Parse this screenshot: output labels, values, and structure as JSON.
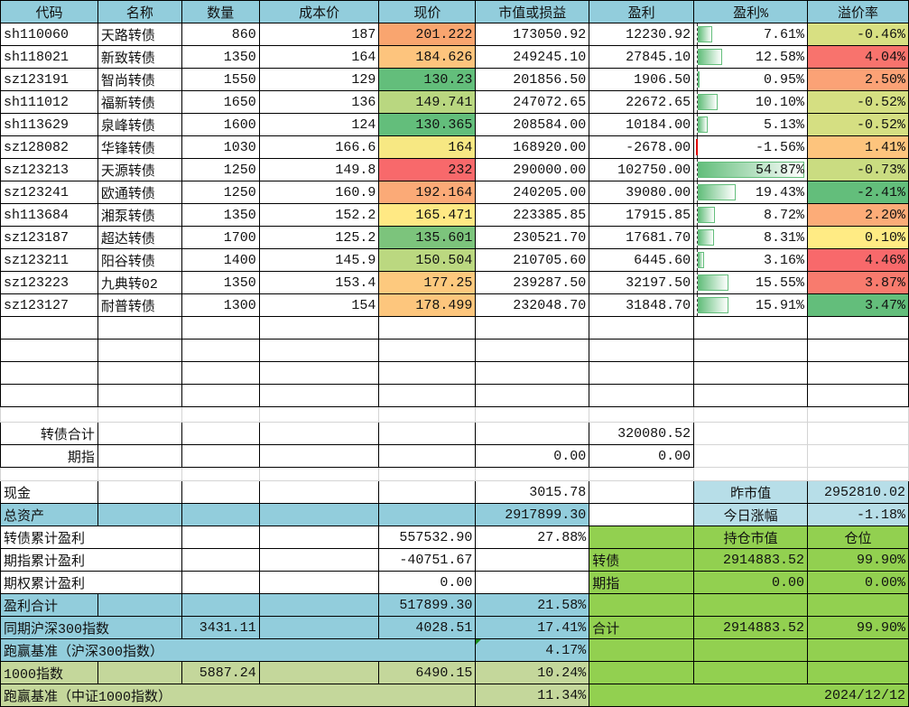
{
  "headers": [
    "代码",
    "名称",
    "数量",
    "成本价",
    "现价",
    "市值或损益",
    "盈利",
    "盈利%",
    "溢价率"
  ],
  "colors": {
    "header": "#92cddc",
    "blue": "#92cddc",
    "light_blue": "#b7dee8",
    "green": "#92d050",
    "olive": "#c4d79b",
    "bar": "#63be7b",
    "negative_bar": "#e00000"
  },
  "holdings": [
    {
      "code": "sh110060",
      "name": "天路转债",
      "qty": "860",
      "cost": "187",
      "price": "201.222",
      "mv": "173050.92",
      "profit": "12230.92",
      "profit_pct": "7.61%",
      "pct": 7.61,
      "premium": "-0.46%",
      "price_color": "#f9a56f",
      "premium_color": "#d8e082"
    },
    {
      "code": "sh118021",
      "name": "新致转债",
      "qty": "1350",
      "cost": "164",
      "price": "184.626",
      "mv": "249245.10",
      "profit": "27845.10",
      "profit_pct": "12.58%",
      "pct": 12.58,
      "premium": "4.04%",
      "price_color": "#fdc47d",
      "premium_color": "#f8736d"
    },
    {
      "code": "sz123191",
      "name": "智尚转债",
      "qty": "1550",
      "cost": "129",
      "price": "130.23",
      "mv": "201856.50",
      "profit": "1906.50",
      "profit_pct": "0.95%",
      "pct": 0.95,
      "premium": "2.50%",
      "price_color": "#63be7b",
      "premium_color": "#fba276"
    },
    {
      "code": "sh111012",
      "name": "福新转债",
      "qty": "1650",
      "cost": "136",
      "price": "149.741",
      "mv": "247072.65",
      "profit": "22672.65",
      "profit_pct": "10.10%",
      "pct": 10.1,
      "premium": "-0.52%",
      "price_color": "#b9d780",
      "premium_color": "#d5df82"
    },
    {
      "code": "sh113629",
      "name": "泉峰转债",
      "qty": "1600",
      "cost": "124",
      "price": "130.365",
      "mv": "208584.00",
      "profit": "10184.00",
      "profit_pct": "5.13%",
      "pct": 5.13,
      "premium": "-0.52%",
      "price_color": "#63be7b",
      "premium_color": "#d5df82"
    },
    {
      "code": "sz128082",
      "name": "华锋转债",
      "qty": "1030",
      "cost": "166.6",
      "price": "164",
      "mv": "168920.00",
      "profit": "-2678.00",
      "profit_pct": "-1.56%",
      "pct": -1.56,
      "premium": "1.41%",
      "price_color": "#f7e883",
      "premium_color": "#fdc47d"
    },
    {
      "code": "sz123213",
      "name": "天源转债",
      "qty": "1250",
      "cost": "149.8",
      "price": "232",
      "mv": "290000.00",
      "profit": "102750.00",
      "profit_pct": "54.87%",
      "pct": 54.87,
      "premium": "-0.73%",
      "price_color": "#f8696b",
      "premium_color": "#cadc81"
    },
    {
      "code": "sz123241",
      "name": "欧通转债",
      "qty": "1250",
      "cost": "160.9",
      "price": "192.164",
      "mv": "240205.00",
      "profit": "39080.00",
      "profit_pct": "19.43%",
      "pct": 19.43,
      "premium": "-2.41%",
      "price_color": "#fbaa77",
      "premium_color": "#63be7b"
    },
    {
      "code": "sh113684",
      "name": "湘泵转债",
      "qty": "1350",
      "cost": "152.2",
      "price": "165.471",
      "mv": "223385.85",
      "profit": "17915.85",
      "profit_pct": "8.72%",
      "pct": 8.72,
      "premium": "2.20%",
      "price_color": "#ffe984",
      "premium_color": "#fcac78"
    },
    {
      "code": "sz123187",
      "name": "超达转债",
      "qty": "1700",
      "cost": "125.2",
      "price": "135.601",
      "mv": "230521.70",
      "profit": "17681.70",
      "profit_pct": "8.31%",
      "pct": 8.31,
      "premium": "0.10%",
      "price_color": "#7cc47c",
      "premium_color": "#ffeb84"
    },
    {
      "code": "sz123211",
      "name": "阳谷转债",
      "qty": "1400",
      "cost": "145.9",
      "price": "150.504",
      "mv": "210705.60",
      "profit": "6445.60",
      "profit_pct": "3.16%",
      "pct": 3.16,
      "premium": "4.46%",
      "price_color": "#bbd880",
      "premium_color": "#f8696b"
    },
    {
      "code": "sz123223",
      "name": "九典转02",
      "qty": "1350",
      "cost": "153.4",
      "price": "177.25",
      "mv": "239287.50",
      "profit": "32197.50",
      "profit_pct": "15.55%",
      "pct": 15.55,
      "premium": "3.87%",
      "price_color": "#fdc97e",
      "premium_color": "#f87b6e"
    },
    {
      "code": "sz123127",
      "name": "耐普转债",
      "qty": "1300",
      "cost": "154",
      "price": "178.499",
      "mv": "232048.70",
      "profit": "31848.70",
      "profit_pct": "15.91%",
      "pct": 15.91,
      "premium": "3.47%",
      "price_color": "#fdc67d",
      "premium_color": "#63be7b"
    }
  ],
  "summary": {
    "bond_total_label": "转债合计",
    "bond_total": "320080.52",
    "futures_label": "期指",
    "futures_mv": "0.00",
    "futures_profit": "0.00",
    "cash_label": "现金",
    "cash": "3015.78",
    "prev_mv_label": "昨市值",
    "prev_mv": "2952810.02",
    "total_assets_label": "总资产",
    "total_assets": "2917899.30",
    "today_change_label": "今日涨幅",
    "today_change": "-1.18%",
    "bond_cum_label": "转债累计盈利",
    "bond_cum": "557532.90",
    "bond_cum_pct": "27.88%",
    "position_mv_label": "持仓市值",
    "position_label": "仓位",
    "fut_cum_label": "期指累计盈利",
    "fut_cum": "-40751.67",
    "pos_bond_label": "转债",
    "pos_bond_mv": "2914883.52",
    "pos_bond_pct": "99.90%",
    "opt_cum_label": "期权累计盈利",
    "opt_cum": "0.00",
    "pos_fut_label": "期指",
    "pos_fut_mv": "0.00",
    "pos_fut_pct": "0.00%",
    "profit_total_label": "盈利合计",
    "profit_total": "517899.30",
    "profit_total_pct": "21.58%",
    "hs300_label": "同期沪深300指数",
    "hs300_start": "3431.11",
    "hs300_now": "4028.51",
    "hs300_pct": "17.41%",
    "pos_total_label": "合计",
    "pos_total_mv": "2914883.52",
    "pos_total_pct": "99.90%",
    "beat_hs300_label": "跑赢基准（沪深300指数）",
    "beat_hs300": "4.17%",
    "csi1000_label": "1000指数",
    "csi1000_start": "5887.24",
    "csi1000_now": "6490.15",
    "csi1000_pct": "10.24%",
    "beat_csi1000_label": "跑赢基准（中证1000指数）",
    "beat_csi1000": "11.34%",
    "date": "2024/12/12"
  }
}
